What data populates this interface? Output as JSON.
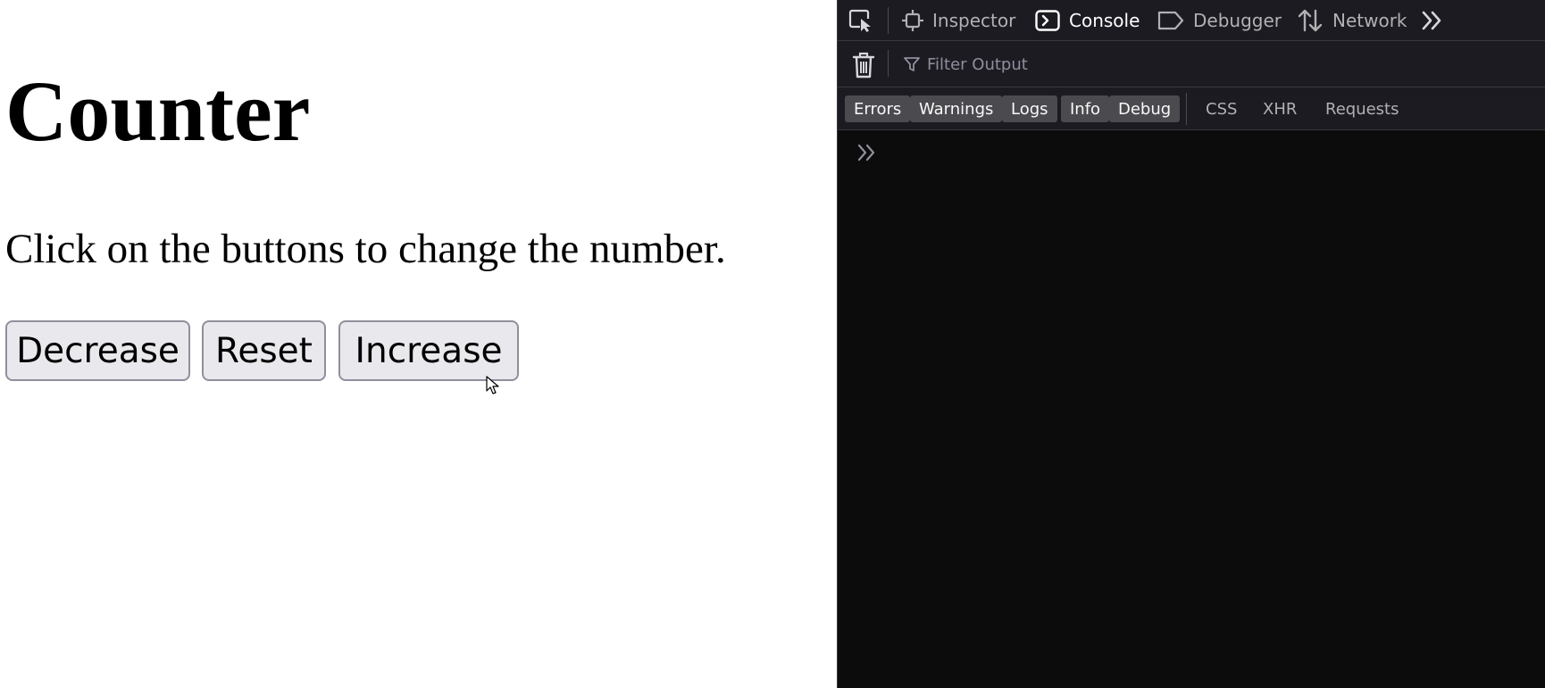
{
  "page": {
    "title": "Counter",
    "description": "Click on the buttons to change the number.",
    "buttons": {
      "decrease": "Decrease",
      "reset": "Reset",
      "increase": "Increase"
    }
  },
  "devtools": {
    "tabs": {
      "inspector": "Inspector",
      "console": "Console",
      "debugger": "Debugger",
      "network": "Network"
    },
    "selected_tab": "Console",
    "filter_placeholder": "Filter Output",
    "levels": {
      "errors": "Errors",
      "warnings": "Warnings",
      "logs": "Logs",
      "info": "Info",
      "debug": "Debug",
      "css": "CSS",
      "xhr": "XHR",
      "requests": "Requests"
    }
  },
  "colors": {
    "devtools_bg": "#0c0c0d",
    "toolbar_bg": "#1c1b22",
    "button_bg": "#e9e9ed",
    "button_border": "#8f8f9d",
    "level_active_bg": "#4a4a4f"
  },
  "icons": {
    "picker": "element-picker-icon",
    "inspector": "inspector-icon",
    "console": "console-icon",
    "debugger": "debugger-icon",
    "network": "network-icon",
    "more": "chevrons-right-icon",
    "trash": "trash-icon",
    "filter": "filter-icon",
    "prompt": "console-prompt-icon"
  }
}
